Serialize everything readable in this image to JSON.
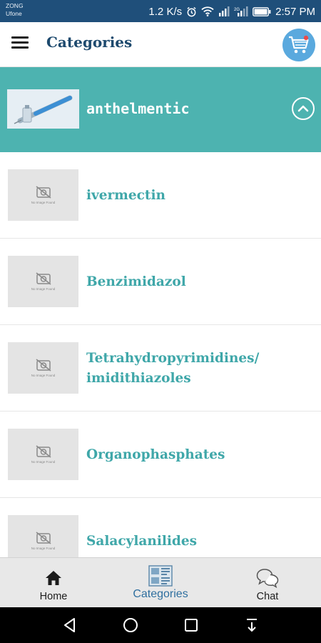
{
  "status_bar": {
    "carrier_1": "ZONG",
    "carrier_2": "Ufone",
    "speed": "1.2 K/s",
    "sim_label": "2G",
    "battery_icon": "battery-icon",
    "time": "2:57 PM"
  },
  "app_bar": {
    "menu_icon": "hamburger-menu-icon",
    "title": "Categories",
    "cart_icon": "shopping-cart-icon"
  },
  "category_header": {
    "name": "anthelmentic",
    "collapse_icon": "chevron-up-icon"
  },
  "items": [
    {
      "label": "ivermectin",
      "image_text": "No Image Found"
    },
    {
      "label": "Benzimidazol",
      "image_text": "No Image Found"
    },
    {
      "label": "Tetrahydropyrimidines/ imidithiazoles",
      "image_text": "No Image Found"
    },
    {
      "label": "Organophasphates",
      "image_text": "No Image Found"
    },
    {
      "label": "Salacylanilides",
      "image_text": "No Image Found"
    }
  ],
  "bottom_nav": {
    "items": [
      {
        "label": "Home",
        "icon": "home-icon"
      },
      {
        "label": "Categories",
        "icon": "categories-icon",
        "active": true
      },
      {
        "label": "Chat",
        "icon": "chat-icon"
      }
    ]
  },
  "colors": {
    "status_bar": "#1f4f7a",
    "title": "#1e4a6e",
    "category_header": "#4db3b0",
    "item_label": "#3fa7a9",
    "active_nav": "#2f6f9f"
  }
}
